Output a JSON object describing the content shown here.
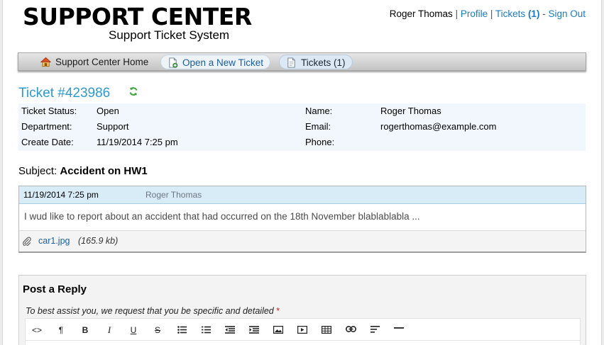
{
  "header": {
    "logo_title": "SUPPORT CENTER",
    "logo_subtitle": "Support Ticket System",
    "user_name": "Roger Thomas",
    "sep1": "|",
    "sep2": "|",
    "sep3": "-",
    "profile_link": "Profile",
    "tickets_link": "Tickets",
    "tickets_count": "(1)",
    "signout_link": "Sign Out"
  },
  "nav": {
    "home": "Support Center Home",
    "open_ticket": "Open a New Ticket",
    "tickets": "Tickets (1)"
  },
  "ticket": {
    "title": "Ticket #423986",
    "status_label": "Ticket Status:",
    "status_value": "Open",
    "department_label": "Department:",
    "department_value": "Support",
    "create_date_label": "Create Date:",
    "create_date_value": "11/19/2014 7:25 pm",
    "name_label": "Name:",
    "name_value": "Roger Thomas",
    "email_label": "Email:",
    "email_value": "rogerthomas@example.com",
    "phone_label": "Phone:",
    "phone_value": ""
  },
  "subject": {
    "label": "Subject:",
    "value": "Accident on HW1"
  },
  "thread": {
    "date": "11/19/2014 7:25 pm",
    "poster": "Roger Thomas",
    "body": "I wud like to report about an accident that had occurred on the 18th November blablablabla ...",
    "attachment_name": "car1.jpg",
    "attachment_size": "(165.9 kb)"
  },
  "reply": {
    "title": "Post a Reply",
    "hint": "To best assist you, we request that you be specific and detailed",
    "required_mark": "*",
    "toolbar": {
      "html": "<>",
      "paragraph": "¶",
      "bold": "B",
      "italic": "I",
      "underline": "U",
      "strike": "S"
    }
  },
  "colors": {
    "title_blue": "#2b9bcf",
    "link_blue": "#1a7bbf",
    "info_bg": "#f1f7fc",
    "thread_head_bg": "#d8ecf8"
  }
}
